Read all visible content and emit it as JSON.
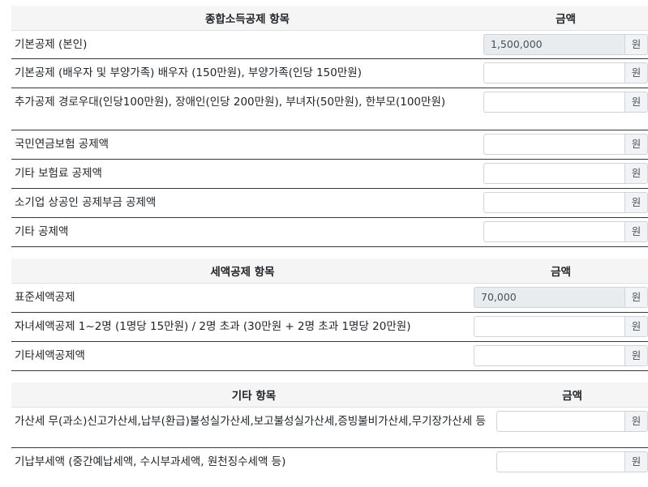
{
  "unit": "원",
  "sections": [
    {
      "header_item": "종합소득공제 항목",
      "header_amount": "금액",
      "rows": [
        {
          "label": "기본공제 (본인)",
          "value": "1,500,000",
          "readonly": true
        },
        {
          "label": "기본공제 (배우자 및 부양가족) 배우자 (150만원), 부양가족(인당 150만원)",
          "value": "",
          "readonly": false
        },
        {
          "label": "추가공제 경로우대(인당100만원), 장애인(인당 200만원), 부녀자(50만원), 한부모(100만원)",
          "value": "",
          "readonly": false
        },
        {
          "label": "국민연금보험 공제액",
          "value": "",
          "readonly": false
        },
        {
          "label": "기타 보험료 공제액",
          "value": "",
          "readonly": false
        },
        {
          "label": "소기업 상공인 공제부금 공제액",
          "value": "",
          "readonly": false
        },
        {
          "label": "기타 공제액",
          "value": "",
          "readonly": false
        }
      ]
    },
    {
      "header_item": "세액공제 항목",
      "header_amount": "금액",
      "rows": [
        {
          "label": "표준세액공제",
          "value": "70,000",
          "readonly": true
        },
        {
          "label": "자녀세액공제 1~2명 (1명당 15만원) / 2명 초과 (30만원 + 2명 초과 1명당 20만원)",
          "value": "",
          "readonly": false
        },
        {
          "label": "기타세액공제액",
          "value": "",
          "readonly": false
        }
      ]
    },
    {
      "header_item": "기타 항목",
      "header_amount": "금액",
      "rows": [
        {
          "label": "가산세 무(과소)신고가산세,납부(환급)불성실가산세,보고불성실가산세,증빙불비가산세,무기장가산세 등",
          "value": "",
          "readonly": false
        },
        {
          "label": "기납부세액 (중간예납세액, 수시부과세액, 원천징수세액 등)",
          "value": "",
          "readonly": false
        }
      ]
    }
  ]
}
